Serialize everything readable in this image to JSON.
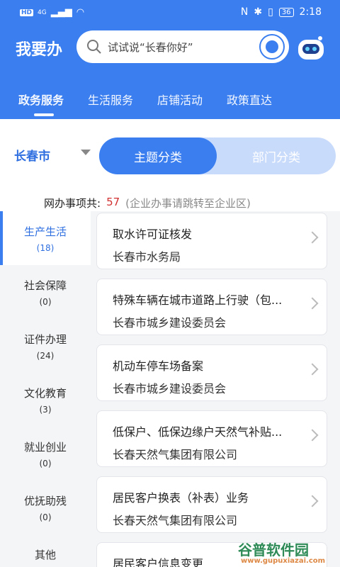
{
  "statusbar": {
    "hd": "HD",
    "net": "4G",
    "battery": "36",
    "time": "2:18"
  },
  "header": {
    "title": "我要办",
    "search_placeholder": "试试说“长春你好”"
  },
  "tabs": [
    {
      "label": "政务服务"
    },
    {
      "label": "生活服务"
    },
    {
      "label": "店铺活动"
    },
    {
      "label": "政策直达"
    }
  ],
  "filter": {
    "city": "长春市",
    "seg_theme": "主题分类",
    "seg_dept": "部门分类"
  },
  "summary": {
    "label": "网办事项共:",
    "count": "57",
    "note": "(企业办事请跳转至企业区)"
  },
  "sidebar": [
    {
      "label": "生产生活",
      "count": "(18)"
    },
    {
      "label": "社会保障",
      "count": "(0)"
    },
    {
      "label": "证件办理",
      "count": "(24)"
    },
    {
      "label": "文化教育",
      "count": "(3)"
    },
    {
      "label": "就业创业",
      "count": "(0)"
    },
    {
      "label": "优抚助残",
      "count": "(0)"
    },
    {
      "label": "其他",
      "count": ""
    }
  ],
  "items": [
    {
      "title": "取水许可证核发",
      "dept": "长春市水务局"
    },
    {
      "title": "特殊车辆在城市道路上行驶（包...",
      "dept": "长春市城乡建设委员会"
    },
    {
      "title": "机动车停车场备案",
      "dept": "长春市城乡建设委员会"
    },
    {
      "title": "低保户、低保边缘户天然气补贴...",
      "dept": "长春天然气集团有限公司"
    },
    {
      "title": "居民客户换表（补表）业务",
      "dept": "长春天然气集团有限公司"
    },
    {
      "title": "居民客户信息变更",
      "dept": ""
    }
  ],
  "watermark": {
    "text": "谷普软件园",
    "url": "www.gupuxiazai.com"
  },
  "colors": {
    "primary": "#3a7ef0",
    "count": "#d0302f"
  }
}
